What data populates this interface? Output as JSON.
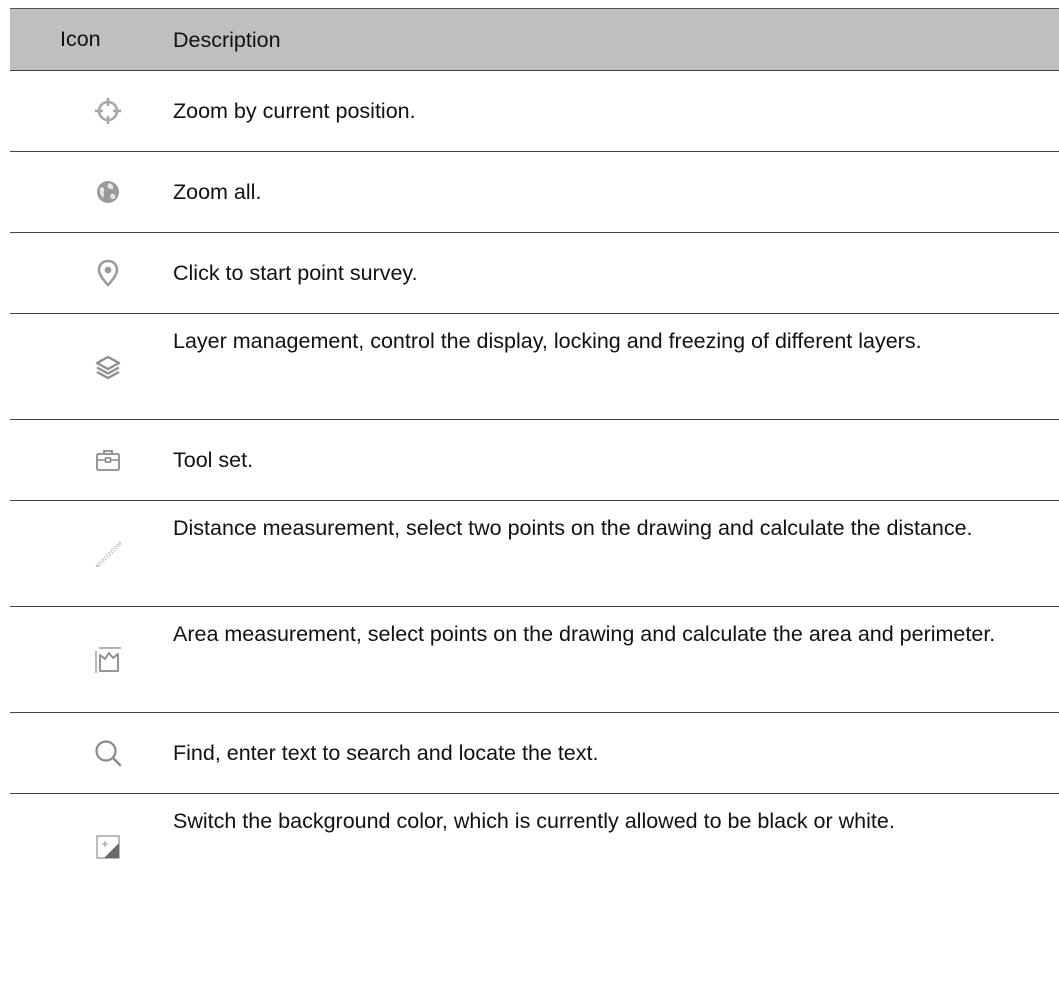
{
  "header": {
    "icon_label": "Icon",
    "description_label": "Description"
  },
  "rows": [
    {
      "icon": "target-crosshair-icon",
      "description": "Zoom by current position."
    },
    {
      "icon": "globe-icon",
      "description": "Zoom all."
    },
    {
      "icon": "location-pin-icon",
      "description": "Click to start point survey."
    },
    {
      "icon": "layers-icon",
      "description": "Layer management, control the display, locking and freezing of different layers."
    },
    {
      "icon": "toolbox-icon",
      "description": "Tool set."
    },
    {
      "icon": "ruler-icon",
      "description": "Distance measurement, select two points on the drawing and calculate the distance."
    },
    {
      "icon": "area-measure-icon",
      "description": "Area measurement, select points on the drawing and calculate the area and perimeter."
    },
    {
      "icon": "search-icon",
      "description": "Find, enter text to search and locate the text."
    },
    {
      "icon": "background-switch-icon",
      "description": "Switch the background color, which is currently allowed to be black or white."
    }
  ],
  "colors": {
    "header_bg": "#bfbfbf",
    "icon_gray": "#9a9a9a",
    "rule": "#444444"
  }
}
